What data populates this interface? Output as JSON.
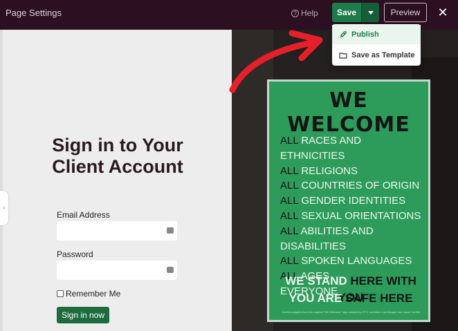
{
  "topbar": {
    "title": "Page Settings",
    "help_label": "Help",
    "save_label": "Save",
    "preview_label": "Preview",
    "close_glyph": "✕"
  },
  "dropdown": {
    "publish_label": "Publish",
    "template_label": "Save as Template"
  },
  "form": {
    "heading": "Sign in to Your Client Account",
    "email_label": "Email Address",
    "email_value": "",
    "password_label": "Password",
    "password_value": "",
    "remember_label": "Remember Me",
    "remember_checked": false,
    "submit_label": "Sign in now"
  },
  "poster": {
    "heading": "WE WELCOME",
    "lines": [
      "RACES AND ETHNICITIES",
      "RELIGIONS",
      "COUNTRIES OF ORIGIN",
      "GENDER IDENTITIES",
      "SEXUAL ORIENTATIONS",
      "ABILITIES AND DISABILITIES",
      "SPOKEN LANGUAGES",
      "AGES"
    ],
    "all_word": "ALL",
    "everyone": "EVERYONE.",
    "tag1_a": "WE STAND",
    "tag1_b": "HERE WITH YOU",
    "tag2_a": "YOU ARE",
    "tag2_b": "SAFE HERE",
    "footnote": "Content adapted from the original \"We Welcome\" sign created by IFYC members Lisa Morgan and Jason Carrillo"
  },
  "colors": {
    "topbar_bg": "#2c1022",
    "accent_green": "#1e7b4b",
    "poster_green": "#2d9c5a",
    "arrow_red": "#e5202b"
  },
  "icons": [
    "help-circle-icon",
    "caret-down-icon",
    "close-icon",
    "rocket-icon",
    "folder-icon",
    "key-icon",
    "chevron-left-icon"
  ]
}
